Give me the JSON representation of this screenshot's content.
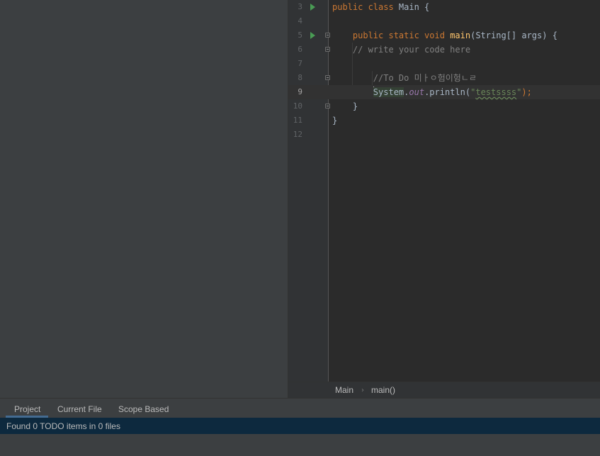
{
  "editor": {
    "lines": [
      {
        "number": "3",
        "parts": [
          {
            "t": "public class ",
            "c": "kw"
          },
          {
            "t": "Main {",
            "c": ""
          }
        ]
      },
      {
        "number": "4",
        "parts": []
      },
      {
        "number": "5",
        "parts": [
          {
            "t": "    ",
            "c": ""
          },
          {
            "t": "public static void ",
            "c": "kw"
          },
          {
            "t": "main",
            "c": "fn"
          },
          {
            "t": "(String[] args) {",
            "c": ""
          }
        ]
      },
      {
        "number": "6",
        "parts": [
          {
            "t": "    ",
            "c": ""
          },
          {
            "t": "// write your code here",
            "c": "cm"
          }
        ]
      },
      {
        "number": "7",
        "parts": []
      },
      {
        "number": "8",
        "parts": [
          {
            "t": "        ",
            "c": ""
          },
          {
            "t": "//To Do 미ㅏㅇ험이헝ㄴㄹ",
            "c": "cm"
          }
        ]
      },
      {
        "number": "9",
        "parts": [
          {
            "t": "        ",
            "c": ""
          },
          {
            "t": "System",
            "c": "hl"
          },
          {
            "t": ".",
            "c": ""
          },
          {
            "t": "out",
            "c": "fld"
          },
          {
            "t": ".println(",
            "c": ""
          },
          {
            "t": "\"",
            "c": "str"
          },
          {
            "t": "testssss",
            "c": "str squiggle"
          },
          {
            "t": "\"",
            "c": "str"
          },
          {
            "t": ");",
            "c": "kw"
          }
        ]
      },
      {
        "number": "10",
        "parts": [
          {
            "t": "    }",
            "c": ""
          }
        ]
      },
      {
        "number": "11",
        "parts": [
          {
            "t": "}",
            "c": ""
          }
        ]
      },
      {
        "number": "12",
        "parts": []
      }
    ]
  },
  "breadcrumb": {
    "class_name": "Main",
    "method_name": "main()"
  },
  "tabs": {
    "project": "Project",
    "current_file": "Current File",
    "scope_based": "Scope Based"
  },
  "status": {
    "message": "Found 0 TODO items in 0 files"
  },
  "colors": {
    "accent": "#4a88c7",
    "status_bg": "#0d293e",
    "editor_bg": "#2b2b2b",
    "panel_bg": "#3c3f41"
  }
}
